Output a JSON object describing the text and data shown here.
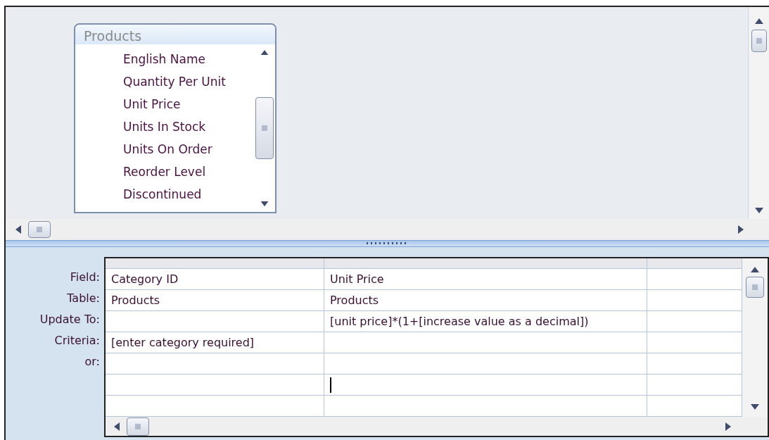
{
  "table_box": {
    "title": "Products",
    "fields": [
      "English Name",
      "Quantity Per Unit",
      "Unit Price",
      "Units In Stock",
      "Units On Order",
      "Reorder Level",
      "Discontinued"
    ]
  },
  "grid": {
    "row_labels": [
      "Field:",
      "Table:",
      "Update To:",
      "Criteria:",
      "or:"
    ],
    "columns": [
      {
        "cells": [
          "Category ID",
          "Products",
          "",
          "[enter category required]",
          "",
          "",
          ""
        ]
      },
      {
        "cells": [
          "Unit Price",
          "Products",
          "[unit price]*(1+[increase value as a decimal])",
          "",
          "",
          "",
          ""
        ]
      },
      {
        "cells": [
          "",
          "",
          "",
          "",
          "",
          "",
          ""
        ]
      }
    ]
  }
}
